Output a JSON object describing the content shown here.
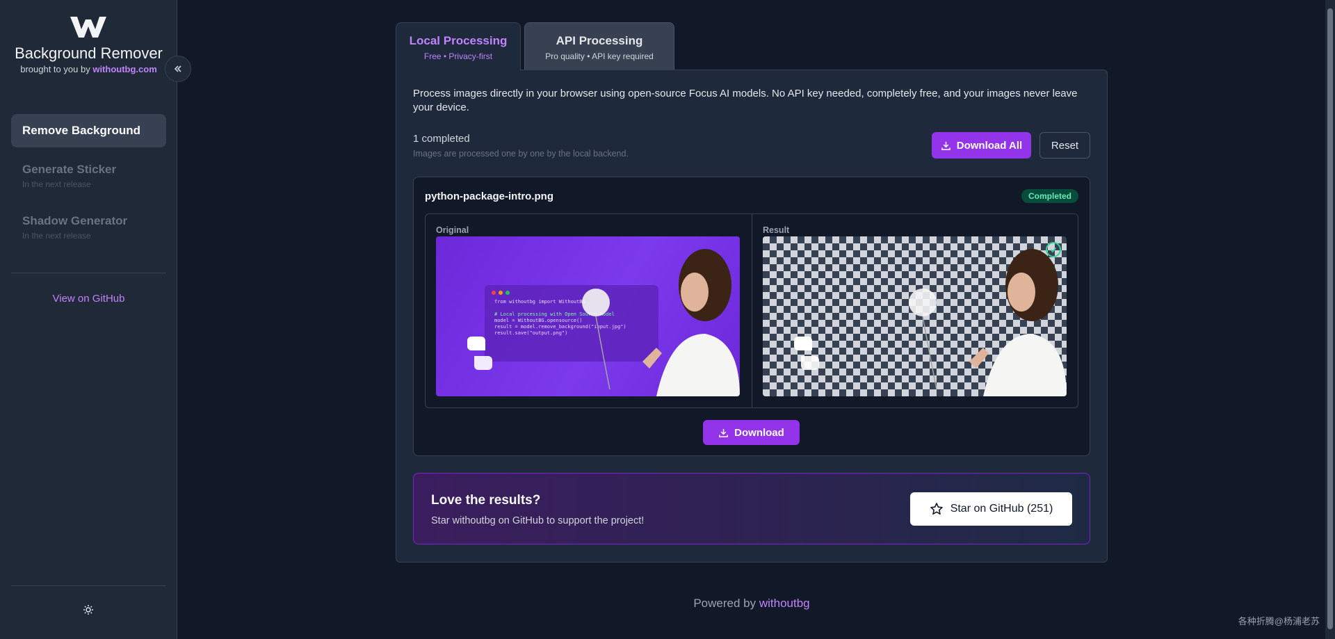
{
  "sidebar": {
    "app_title": "Background Remover",
    "byline_prefix": "brought to you by",
    "byline_link": "withoutbg.com",
    "nav": [
      {
        "label": "Remove Background",
        "sub": ""
      },
      {
        "label": "Generate Sticker",
        "sub": "In the next release"
      },
      {
        "label": "Shadow Generator",
        "sub": "In the next release"
      }
    ],
    "github_link": "View on GitHub"
  },
  "tabs": [
    {
      "label": "Local Processing",
      "sub": "Free • Privacy-first"
    },
    {
      "label": "API Processing",
      "sub": "Pro quality • API key required"
    }
  ],
  "panel": {
    "description": "Process images directly in your browser using open-source Focus AI models. No API key needed, completely free, and your images never leave your device.",
    "completed_text": "1 completed",
    "processed_note": "Images are processed one by one by the local backend.",
    "download_all": "Download All",
    "reset": "Reset"
  },
  "card": {
    "filename": "python-package-intro.png",
    "status": "Completed",
    "original_label": "Original",
    "result_label": "Result",
    "code_lines": [
      "from withoutbg import WithoutBG",
      "",
      "# Local processing with Open Source model",
      "model = WithoutBG.opensource()",
      "result = model.remove_background(\"input.jpg\")",
      "result.save(\"output.png\")"
    ],
    "download": "Download"
  },
  "promo": {
    "title": "Love the results?",
    "subtitle": "Star withoutbg on GitHub to support the project!",
    "button": "Star on GitHub (251)"
  },
  "footer": {
    "prefix": "Powered by",
    "link": "withoutbg"
  },
  "watermark": "各种折腾@杨浦老苏",
  "colors": {
    "accent": "#9333ea",
    "accent_text": "#c084fc",
    "success": "#34d399"
  }
}
